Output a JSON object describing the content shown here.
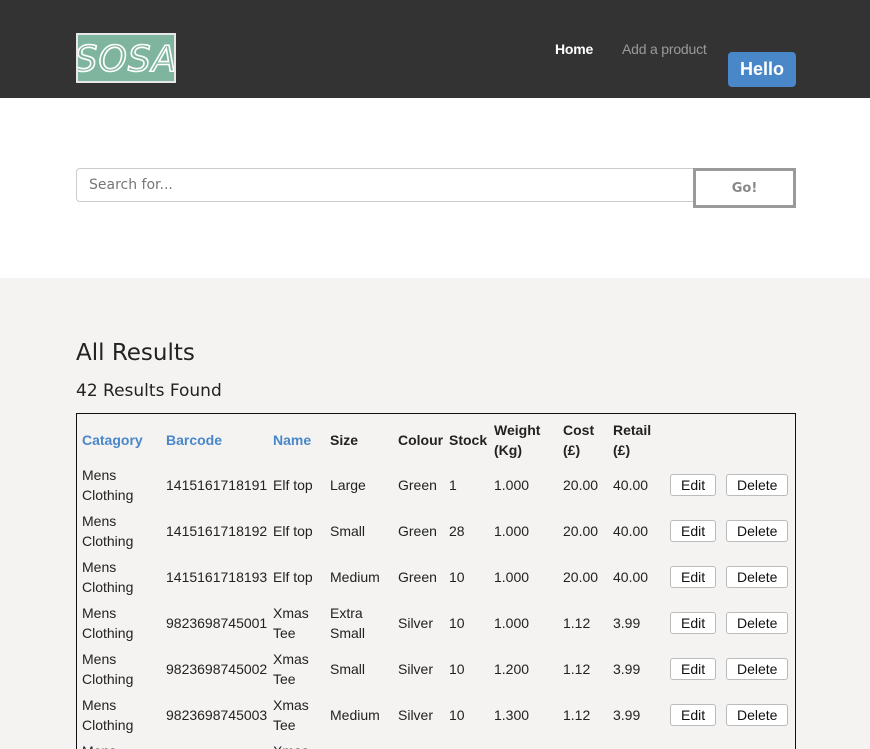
{
  "nav": {
    "logo_text": "SOSA",
    "home_label": "Home",
    "add_product_label": "Add a product",
    "hello_label": "Hello"
  },
  "search": {
    "placeholder": "Search for...",
    "go_label": "Go!"
  },
  "results": {
    "title": "All Results",
    "count": "42 Results Found"
  },
  "table": {
    "headers": {
      "category": "Catagory",
      "barcode": "Barcode",
      "name": "Name",
      "size": "Size",
      "colour": "Colour",
      "stock": "Stock",
      "weight": "Weight (Kg)",
      "cost": "Cost (£)",
      "retail": "Retail (£)"
    },
    "edit_label": "Edit",
    "delete_label": "Delete",
    "rows": [
      {
        "category": "Mens Clothing",
        "barcode": "1415161718191",
        "name": "Elf top",
        "size": "Large",
        "colour": "Green",
        "stock": "1",
        "weight": "1.000",
        "cost": "20.00",
        "retail": "40.00"
      },
      {
        "category": "Mens Clothing",
        "barcode": "1415161718192",
        "name": "Elf top",
        "size": "Small",
        "colour": "Green",
        "stock": "28",
        "weight": "1.000",
        "cost": "20.00",
        "retail": "40.00"
      },
      {
        "category": "Mens Clothing",
        "barcode": "1415161718193",
        "name": "Elf top",
        "size": "Medium",
        "colour": "Green",
        "stock": "10",
        "weight": "1.000",
        "cost": "20.00",
        "retail": "40.00"
      },
      {
        "category": "Mens Clothing",
        "barcode": "9823698745001",
        "name": "Xmas Tee",
        "size": "Extra Small",
        "colour": "Silver",
        "stock": "10",
        "weight": "1.000",
        "cost": "1.12",
        "retail": "3.99"
      },
      {
        "category": "Mens Clothing",
        "barcode": "9823698745002",
        "name": "Xmas Tee",
        "size": "Small",
        "colour": "Silver",
        "stock": "10",
        "weight": "1.200",
        "cost": "1.12",
        "retail": "3.99"
      },
      {
        "category": "Mens Clothing",
        "barcode": "9823698745003",
        "name": "Xmas Tee",
        "size": "Medium",
        "colour": "Silver",
        "stock": "10",
        "weight": "1.300",
        "cost": "1.12",
        "retail": "3.99"
      },
      {
        "category": "Mens Clothing",
        "barcode": "",
        "name": "Xmas Tee",
        "size": "",
        "colour": "",
        "stock": "",
        "weight": "",
        "cost": "",
        "retail": ""
      }
    ]
  }
}
